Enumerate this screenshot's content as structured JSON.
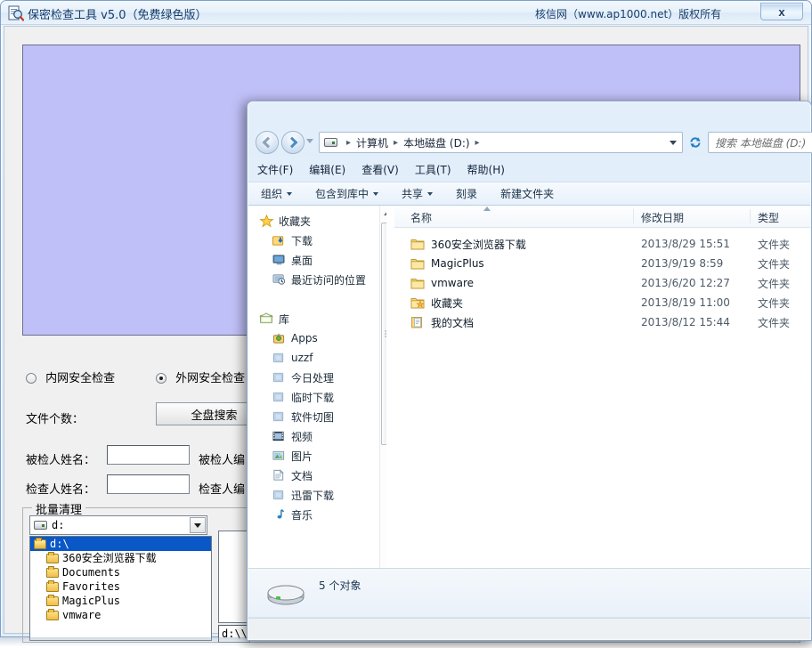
{
  "app": {
    "title": "保密检查工具 v5.0（免费绿色版）",
    "copyright": "核信网（www.ap1000.net）版权所有",
    "close_label": "x",
    "icon": "magnifier-document-icon",
    "radios": [
      {
        "label": "内网安全检查",
        "selected": false
      },
      {
        "label": "外网安全检查",
        "selected": true
      }
    ],
    "file_count_label": "文件个数：",
    "full_scan_button": "全盘搜索",
    "fields": [
      {
        "label": "被检人姓名：",
        "value": "",
        "right_label": "被检人编"
      },
      {
        "label": "检查人姓名：",
        "value": "",
        "right_label": "检查人编"
      }
    ],
    "batch_group_title": "批量清理",
    "drive_combo_value": "d:",
    "tree": [
      {
        "label": "d:\\",
        "selected": true,
        "child": false
      },
      {
        "label": "360安全浏览器下载",
        "selected": false,
        "child": true
      },
      {
        "label": "Documents",
        "selected": false,
        "child": true
      },
      {
        "label": "Favorites",
        "selected": false,
        "child": true
      },
      {
        "label": "MagicPlus",
        "selected": false,
        "child": true
      },
      {
        "label": "vmware",
        "selected": false,
        "child": true
      }
    ],
    "path_value": "d:\\\\"
  },
  "explorer": {
    "nav_back_icon": "back-arrow-icon",
    "nav_forward_icon": "forward-arrow-icon",
    "breadcrumb": [
      "计算机",
      "本地磁盘 (D:)"
    ],
    "breadcrumb_sep": "▸",
    "refresh_icon": "refresh-icon",
    "search_placeholder": "搜索 本地磁盘 (D:)",
    "menu": [
      "文件(F)",
      "编辑(E)",
      "查看(V)",
      "工具(T)",
      "帮助(H)"
    ],
    "toolbar": [
      {
        "label": "组织",
        "caret": true
      },
      {
        "label": "包含到库中",
        "caret": true
      },
      {
        "label": "共享",
        "caret": true
      },
      {
        "label": "刻录",
        "caret": false
      },
      {
        "label": "新建文件夹",
        "caret": false
      }
    ],
    "navpane": [
      {
        "label": "收藏夹",
        "icon": "star-icon",
        "level": "root"
      },
      {
        "label": "下载",
        "icon": "download-folder-icon",
        "level": "child"
      },
      {
        "label": "桌面",
        "icon": "desktop-icon",
        "level": "child"
      },
      {
        "label": "最近访问的位置",
        "icon": "recent-places-icon",
        "level": "child"
      },
      {
        "label": "",
        "icon": "",
        "level": "spacer"
      },
      {
        "label": "库",
        "icon": "library-icon",
        "level": "root"
      },
      {
        "label": "Apps",
        "icon": "apps-library-icon",
        "level": "child"
      },
      {
        "label": "uzzf",
        "icon": "library-folder-icon",
        "level": "child"
      },
      {
        "label": "今日处理",
        "icon": "library-folder-icon",
        "level": "child"
      },
      {
        "label": "临时下载",
        "icon": "library-folder-icon",
        "level": "child"
      },
      {
        "label": "软件切图",
        "icon": "library-folder-icon",
        "level": "child"
      },
      {
        "label": "视频",
        "icon": "video-library-icon",
        "level": "child"
      },
      {
        "label": "图片",
        "icon": "pictures-library-icon",
        "level": "child"
      },
      {
        "label": "文档",
        "icon": "documents-library-icon",
        "level": "child"
      },
      {
        "label": "迅雷下载",
        "icon": "library-folder-icon",
        "level": "child"
      },
      {
        "label": "音乐",
        "icon": "music-library-icon",
        "level": "child"
      }
    ],
    "columns": [
      "名称",
      "修改日期",
      "类型"
    ],
    "sort_column": "名称",
    "sort_direction": "ascending",
    "rows": [
      {
        "name": "360安全浏览器下载",
        "date": "2013/8/29 15:51",
        "type": "文件夹",
        "icon": "folder-icon"
      },
      {
        "name": "MagicPlus",
        "date": "2013/9/19 8:59",
        "type": "文件夹",
        "icon": "folder-icon"
      },
      {
        "name": "vmware",
        "date": "2013/6/20 12:27",
        "type": "文件夹",
        "icon": "folder-icon"
      },
      {
        "name": "收藏夹",
        "date": "2013/8/19 11:00",
        "type": "文件夹",
        "icon": "favorites-folder-icon"
      },
      {
        "name": "我的文档",
        "date": "2013/8/12 15:44",
        "type": "文件夹",
        "icon": "documents-folder-icon"
      }
    ],
    "status_text": "5 个对象",
    "status_icon": "hard-drive-icon"
  },
  "colors": {
    "preview_panel": "#c0c0f8",
    "tree_selection": "#0a58c8",
    "explorer_chrome": "#dbe9f6"
  }
}
